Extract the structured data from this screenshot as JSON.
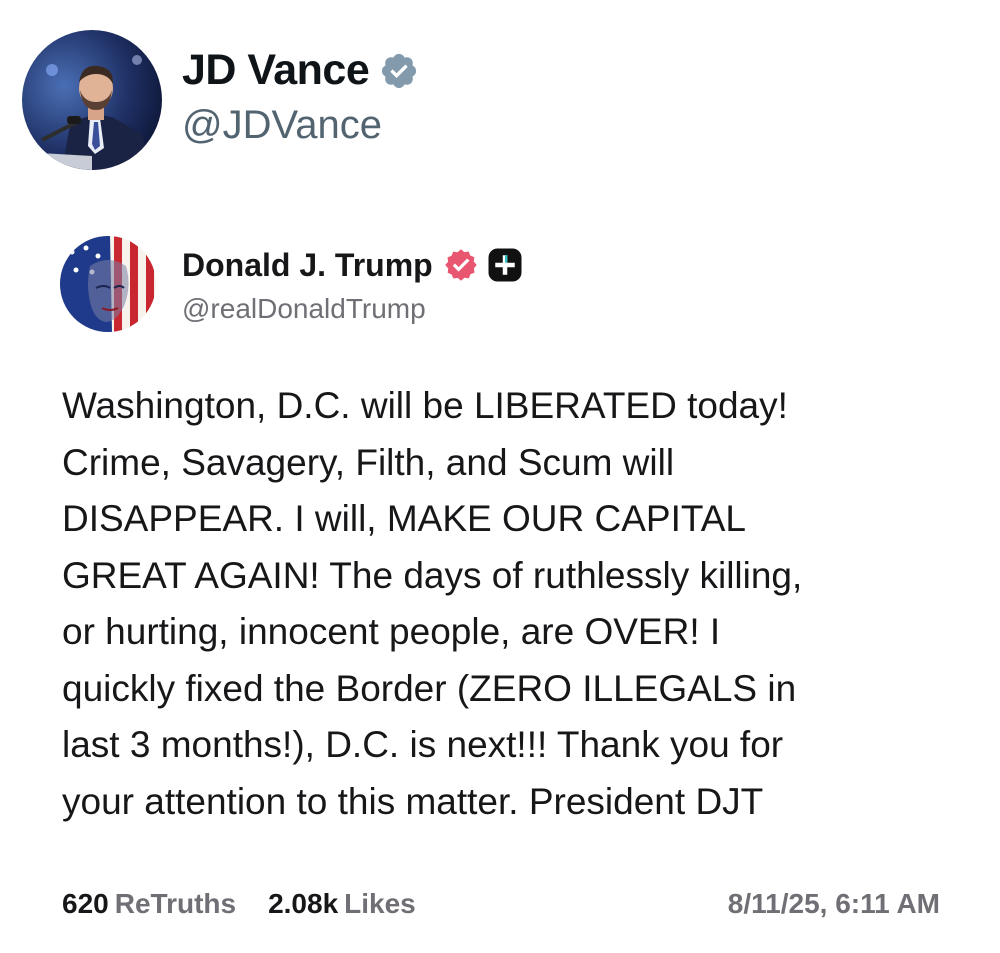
{
  "outer_post": {
    "author_name": "JD Vance",
    "author_handle": "@JDVance",
    "verified": true,
    "verified_color": "#829aab"
  },
  "quoted_post": {
    "author_name": "Donald J. Trump",
    "author_handle": "@realDonaldTrump",
    "verified": true,
    "verified_color": "#e8576f",
    "plus_badge": "plus-badge-icon",
    "body_lines": [
      "Washington, D.C. will be LIBERATED today!",
      "Crime, Savagery, Filth, and Scum will",
      "DISAPPEAR. I will, MAKE OUR CAPITAL",
      "GREAT AGAIN! The days of ruthlessly killing,",
      "or hurting, innocent people, are OVER! I",
      "quickly fixed the Border (ZERO ILLEGALS in",
      "last 3 months!), D.C. is next!!! Thank you for",
      "your attention to this matter. President DJT"
    ],
    "retruths_count": "620",
    "retruths_label": "ReTruths",
    "likes_count": "2.08k",
    "likes_label": "Likes",
    "timestamp": "8/11/25, 6:11 AM"
  }
}
